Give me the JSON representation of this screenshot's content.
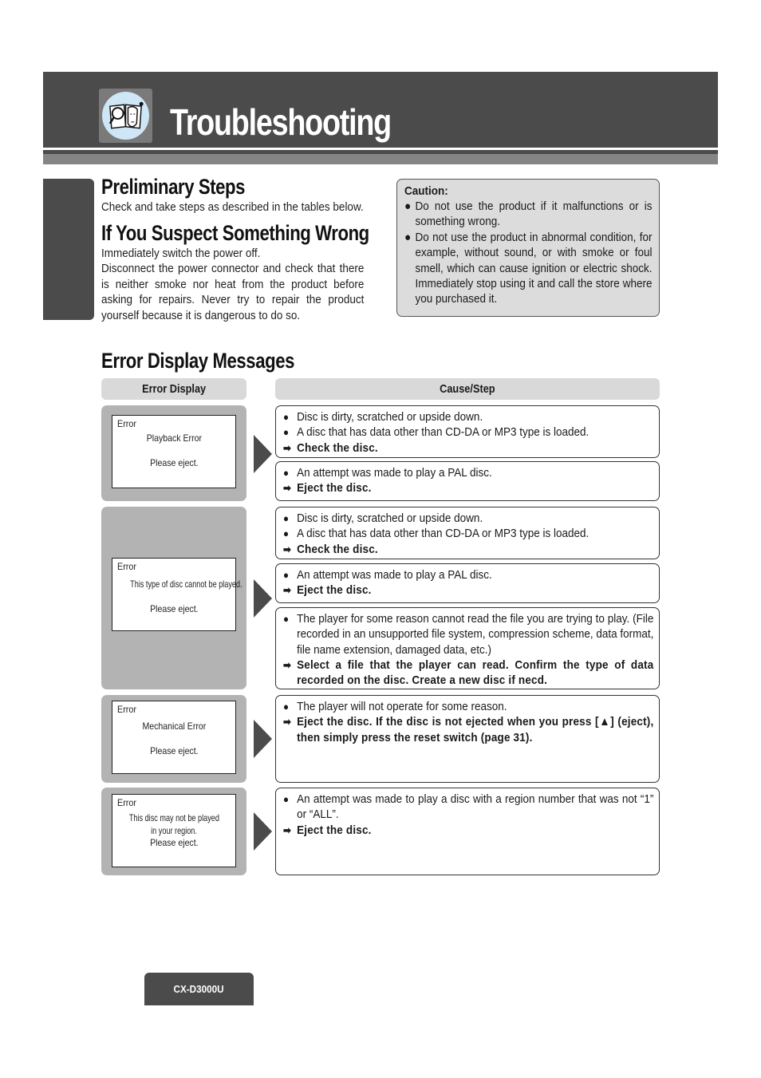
{
  "header": {
    "title": "Troubleshooting",
    "icon": "manual-magnifier-icon"
  },
  "preliminary": {
    "heading": "Preliminary Steps",
    "text": "Check and take steps as described in the tables below."
  },
  "suspect": {
    "heading": "If You Suspect Something Wrong",
    "line1": "Immediately switch the power off.",
    "line2": "Disconnect the power connector and check that there is neither smoke nor heat from the product before asking for repairs. Never try to repair the product yourself because it is dangerous to do so."
  },
  "caution": {
    "title": "Caution:",
    "items": [
      "Do not use the product if it malfunctions or is something wrong.",
      "Do not use the product in abnormal condition, for example, without sound, or with smoke or foul smell, which can cause ignition or electric shock. Immediately stop using it and call the store where you purchased it."
    ]
  },
  "errors": {
    "heading": "Error Display Messages",
    "col_display": "Error Display",
    "col_cause": "Cause/Step",
    "bullet": "●",
    "arrow": "➡",
    "groups": [
      {
        "screen": {
          "label": "Error",
          "line1": "Playback Error",
          "line2": "Please eject."
        },
        "causes": [
          {
            "bullets": [
              "Disc is dirty, scratched or upside down.",
              "A disc that has data other than CD-DA or MP3 type is loaded."
            ],
            "step": "Check the disc."
          },
          {
            "bullets": [
              "An attempt was made to play a PAL disc."
            ],
            "step": "Eject the disc."
          }
        ]
      },
      {
        "screen": {
          "label": "Error",
          "line1": "This type of disc cannot be played.",
          "line2": "Please eject."
        },
        "causes": [
          {
            "bullets": [
              "Disc is dirty, scratched or upside down.",
              "A disc that has data other than CD-DA or MP3 type is loaded."
            ],
            "step": "Check the disc."
          },
          {
            "bullets": [
              "An attempt was made to play a PAL disc."
            ],
            "step": "Eject the disc."
          },
          {
            "bullets": [
              "The player for some reason cannot read the file you are trying to play. (File recorded in an unsupported file system, compression scheme, data format, file name extension, damaged data, etc.)"
            ],
            "step": "Select a file that the player can read. Confirm the type of data recorded on the disc. Create a new disc if necd."
          }
        ]
      },
      {
        "screen": {
          "label": "Error",
          "line1": "Mechanical Error",
          "line2": "Please eject."
        },
        "causes": [
          {
            "bullets": [
              "The player will not operate for some reason."
            ],
            "step": "Eject the disc. If the disc is not ejected when you press [▲] (eject), then simply press the reset switch (page 31)."
          }
        ]
      },
      {
        "screen": {
          "label": "Error",
          "line1": "This disc may not be played",
          "line1b": "in your region.",
          "line2": "Please eject."
        },
        "causes": [
          {
            "bullets": [
              "An attempt was made to play a disc with a region number that was not “1” or “ALL”."
            ],
            "step": "Eject the disc."
          }
        ]
      }
    ]
  },
  "footer": {
    "model": "CX-D3000U"
  }
}
